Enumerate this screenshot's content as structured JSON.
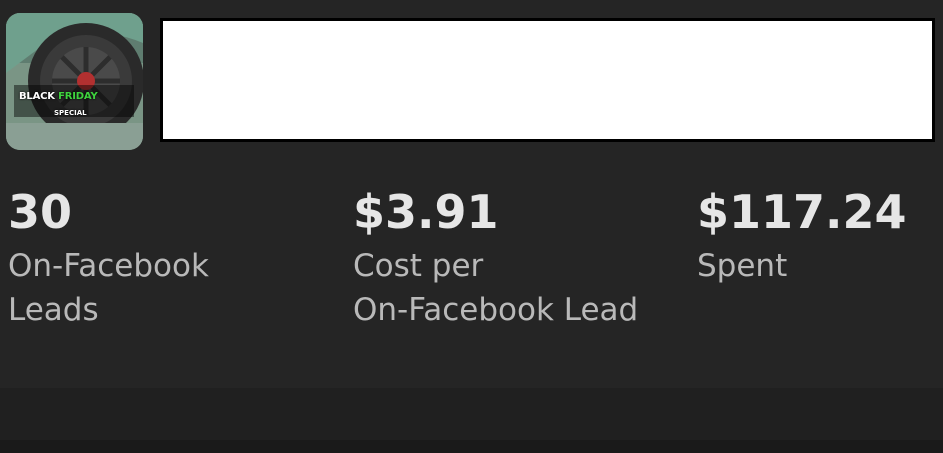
{
  "ad": {
    "thumbnail": {
      "promo_word1": "BLACK",
      "promo_word2": "FRIDAY",
      "promo_sub": "SPECIAL",
      "accent_green": "#3ed33e"
    }
  },
  "metrics": [
    {
      "value": "30",
      "label_line1": "On-Facebook",
      "label_line2": "Leads"
    },
    {
      "value": "$3.91",
      "label_line1": "Cost per",
      "label_line2": "On-Facebook Lead"
    },
    {
      "value": "$117.24",
      "label_line1": "Spent",
      "label_line2": ""
    }
  ],
  "colors": {
    "background": "#252525",
    "value_text": "#e6e6e6",
    "label_text": "#b9b9b9"
  }
}
